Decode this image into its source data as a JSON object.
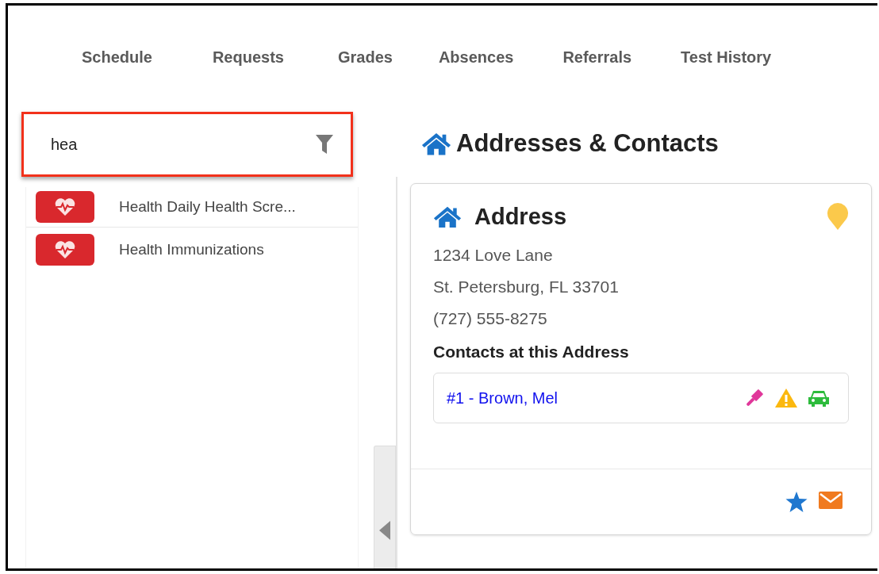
{
  "tabs": [
    "Schedule",
    "Requests",
    "Grades",
    "Absences",
    "Referrals",
    "Test History"
  ],
  "search": {
    "value": "hea"
  },
  "results": [
    {
      "label": "Health Daily Health Scre..."
    },
    {
      "label": "Health Immunizations"
    }
  ],
  "heading": "Addresses & Contacts",
  "card": {
    "title": "Address",
    "lines": [
      "1234 Love Lane",
      "St. Petersburg, FL 33701",
      "(727) 555-8275"
    ],
    "contacts_heading": "Contacts at this Address",
    "contacts": [
      {
        "name": "#1 - Brown, Mel"
      }
    ]
  }
}
